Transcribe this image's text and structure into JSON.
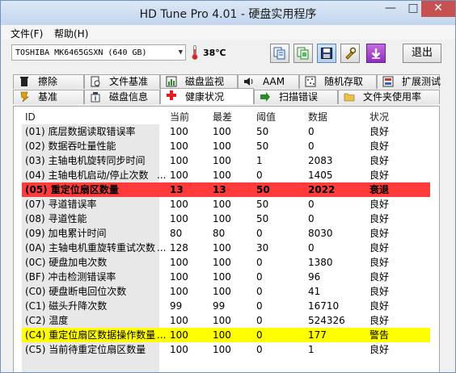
{
  "window": {
    "title": "HD Tune Pro 4.01 - 硬盘实用程序",
    "min": "—",
    "max": "□",
    "close": "✕"
  },
  "menu": {
    "file": "文件(F)",
    "help": "帮助(H)"
  },
  "toolbar": {
    "drive": "TOSHIBA MK6465GSXN (640 GB)",
    "temperature": "38℃",
    "exit": "退出",
    "buttons": [
      "copy-info-icon",
      "copy-screen-icon",
      "save-icon",
      "settings-icon",
      "download-icon"
    ]
  },
  "tabs_top": [
    {
      "label": "擦除",
      "icon": "trash-icon"
    },
    {
      "label": "文件基准",
      "icon": "file-benchmark-icon"
    },
    {
      "label": "磁盘监视",
      "icon": "disk-monitor-icon"
    },
    {
      "label": "AAM",
      "icon": "speaker-icon"
    },
    {
      "label": "随机存取",
      "icon": "random-access-icon"
    },
    {
      "label": "扩展测试",
      "icon": "extra-tests-icon"
    }
  ],
  "tabs_bottom": [
    {
      "label": "基准",
      "icon": "benchmark-icon"
    },
    {
      "label": "磁盘信息",
      "icon": "info-icon"
    },
    {
      "label": "健康状况",
      "icon": "health-cross-icon"
    },
    {
      "label": "扫描错误",
      "icon": "scan-arrow-icon"
    },
    {
      "label": "文件夹使用率",
      "icon": "folder-icon"
    }
  ],
  "table": {
    "headers": [
      "ID",
      "当前",
      "最差",
      "阈值",
      "数据",
      "状况"
    ],
    "rows": [
      [
        "(01) 底层数据读取错误率",
        "100",
        "100",
        "50",
        "0",
        "良好"
      ],
      [
        "(02) 数据吞吐量性能",
        "100",
        "100",
        "50",
        "0",
        "良好"
      ],
      [
        "(03) 主轴电机旋转同步时间",
        "100",
        "100",
        "1",
        "2083",
        "良好"
      ],
      [
        "(04) 主轴电机启动/停止次数",
        "100",
        "100",
        "0",
        "1405",
        "良好"
      ],
      [
        "(05) 重定位扇区数量",
        "13",
        "13",
        "50",
        "2022",
        "衰退"
      ],
      [
        "(07) 寻道错误率",
        "100",
        "100",
        "50",
        "0",
        "良好"
      ],
      [
        "(08) 寻道性能",
        "100",
        "100",
        "50",
        "0",
        "良好"
      ],
      [
        "(09) 加电累计时间",
        "80",
        "80",
        "0",
        "8030",
        "良好"
      ],
      [
        "(0A) 主轴电机重旋转重试次数",
        "128",
        "100",
        "30",
        "0",
        "良好"
      ],
      [
        "(0C) 硬盘加电次数",
        "100",
        "100",
        "0",
        "1380",
        "良好"
      ],
      [
        "(BF) 冲击检测错误率",
        "100",
        "100",
        "0",
        "96",
        "良好"
      ],
      [
        "(C0) 硬盘断电回位次数",
        "100",
        "100",
        "0",
        "41",
        "良好"
      ],
      [
        "(C1) 磁头升降次数",
        "99",
        "99",
        "0",
        "16710",
        "良好"
      ],
      [
        "(C2) 温度",
        "100",
        "100",
        "0",
        "524326",
        "良好"
      ],
      [
        "(C4) 重定位扇区数据操作数量",
        "100",
        "100",
        "0",
        "177",
        "警告"
      ],
      [
        "(C5) 当前待重定位扇区数量",
        "100",
        "100",
        "0",
        "1",
        "良好"
      ]
    ],
    "ellipsis": "..."
  },
  "colors": {
    "warn_red": "#ff3b3b",
    "warn_yellow": "#ffff00",
    "tab_active": "#ffffff"
  }
}
